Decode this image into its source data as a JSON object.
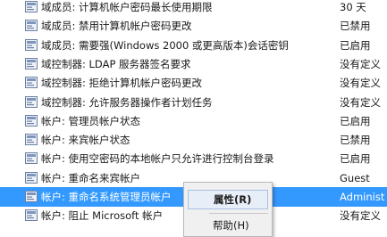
{
  "policies": [
    {
      "label": "域成员: 计算机帐户密码最长使用期限",
      "setting": "30 天"
    },
    {
      "label": "域成员: 禁用计算机帐户密码更改",
      "setting": "已禁用"
    },
    {
      "label": "域成员: 需要强(Windows 2000 或更高版本)会话密钥",
      "setting": "已启用"
    },
    {
      "label": "域控制器: LDAP 服务器签名要求",
      "setting": "没有定义"
    },
    {
      "label": "域控制器: 拒绝计算机帐户密码更改",
      "setting": "没有定义"
    },
    {
      "label": "域控制器: 允许服务器操作者计划任务",
      "setting": "没有定义"
    },
    {
      "label": "帐户: 管理员帐户状态",
      "setting": "已启用"
    },
    {
      "label": "帐户: 来宾帐户状态",
      "setting": "已禁用"
    },
    {
      "label": "帐户: 使用空密码的本地帐户只允许进行控制台登录",
      "setting": "已启用"
    },
    {
      "label": "帐户: 重命名来宾帐户",
      "setting": "Guest"
    },
    {
      "label": "帐户: 重命名系统管理员帐户",
      "setting": "Administ"
    },
    {
      "label": "帐户: 阻止 Microsoft 帐户",
      "setting": "没有定义"
    }
  ],
  "selected_index": 10,
  "context_menu": {
    "properties_label": "属性(R)",
    "help_label": "帮助(H)"
  },
  "colors": {
    "selection": "#3399ff",
    "menu_background": "#f0f0f0"
  }
}
